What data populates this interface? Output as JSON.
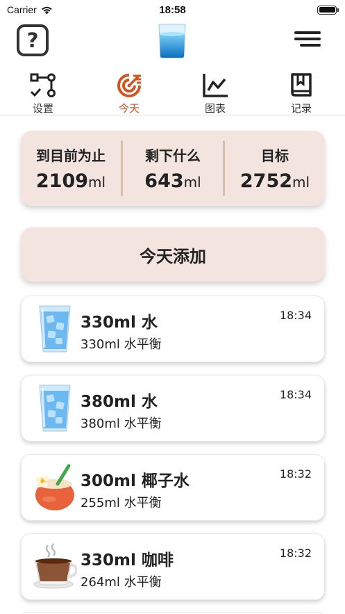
{
  "status_bar": {
    "carrier": "Carrier",
    "time": "18:58"
  },
  "top_nav": {
    "help_label": "?"
  },
  "tabs": [
    {
      "label": "设置",
      "icon": "settings-flow-icon",
      "active": false
    },
    {
      "label": "今天",
      "icon": "today-target-icon",
      "active": true
    },
    {
      "label": "图表",
      "icon": "chart-icon",
      "active": false
    },
    {
      "label": "记录",
      "icon": "book-icon",
      "active": false
    }
  ],
  "summary": {
    "so_far_label": "到目前为止",
    "so_far_value": "2109",
    "remaining_label": "剩下什么",
    "remaining_value": "643",
    "goal_label": "目标",
    "goal_value": "2752",
    "unit": "ml"
  },
  "add_button_label": "今天添加",
  "entries": [
    {
      "title": "330ml 水",
      "subtitle": "330ml 水平衡",
      "time": "18:34",
      "icon": "water-glass-icon"
    },
    {
      "title": "380ml 水",
      "subtitle": "380ml 水平衡",
      "time": "18:34",
      "icon": "water-glass-icon"
    },
    {
      "title": "300ml 椰子水",
      "subtitle": "255ml 水平衡",
      "time": "18:32",
      "icon": "coconut-drink-icon"
    },
    {
      "title": "330ml 咖啡",
      "subtitle": "264ml 水平衡",
      "time": "18:32",
      "icon": "coffee-cup-icon"
    }
  ],
  "colors": {
    "accent": "#d2541e",
    "card": "#f3e4df"
  }
}
